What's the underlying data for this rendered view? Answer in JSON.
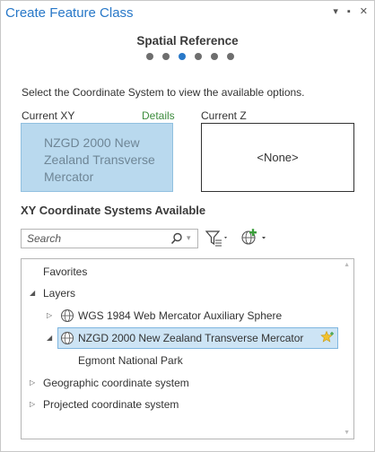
{
  "window": {
    "title": "Create Feature Class",
    "controls": [
      "▾",
      "▪",
      "✕"
    ]
  },
  "wizard": {
    "step_title": "Spatial Reference",
    "total_steps": 6,
    "current_step": 3
  },
  "instructions": "Select the Coordinate System to view the available options.",
  "current_xy": {
    "label": "Current XY",
    "details_link": "Details",
    "value": "NZGD 2000 New Zealand Transverse Mercator"
  },
  "current_z": {
    "label": "Current Z",
    "value": "<None>"
  },
  "available": {
    "title": "XY Coordinate Systems Available",
    "search_placeholder": "Search"
  },
  "tree": {
    "favorites": "Favorites",
    "layers": "Layers",
    "layer_items": [
      "WGS 1984 Web Mercator Auxiliary Sphere",
      "NZGD 2000 New Zealand Transverse Mercator"
    ],
    "sub_item": "Egmont National Park",
    "geographic": "Geographic coordinate system",
    "projected": "Projected coordinate system"
  },
  "colors": {
    "accent": "#2878c8",
    "selection": "#b9d9ee",
    "details_link": "#3d8c3d"
  }
}
